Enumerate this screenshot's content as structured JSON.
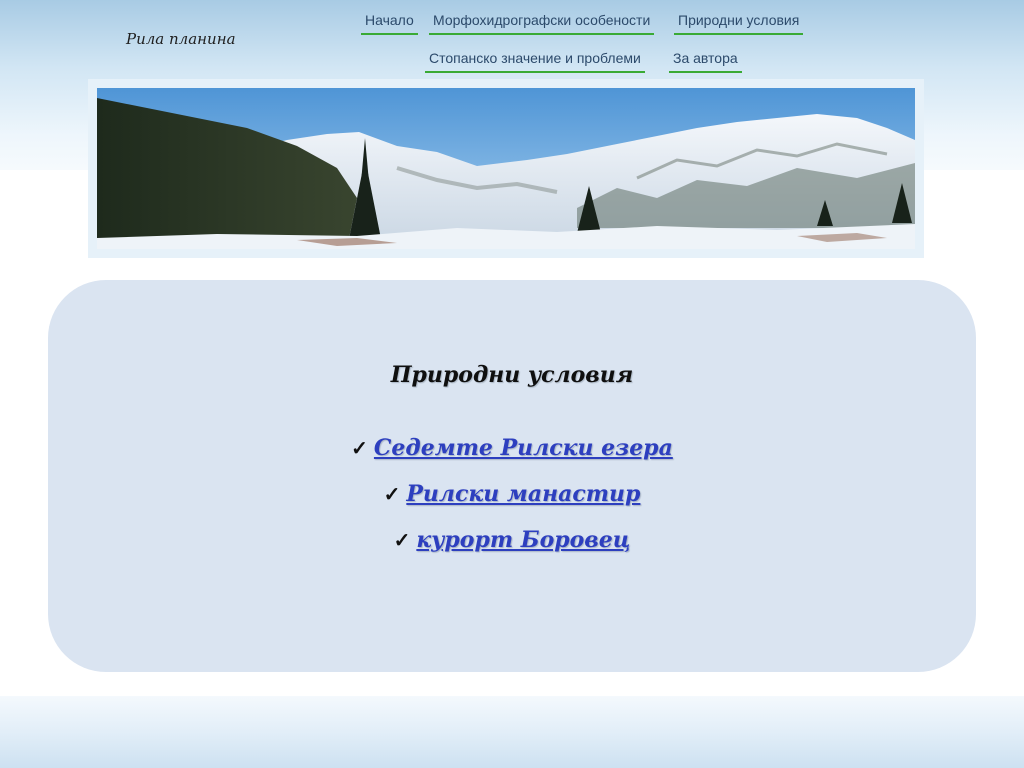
{
  "site": {
    "title": "Рила планина"
  },
  "nav": {
    "row1": [
      "Начало",
      "Морфохидрографски особености",
      "Природни условия"
    ],
    "row2": [
      "Стопанско значение и проблеми",
      "За автора"
    ]
  },
  "banner": {
    "image": "mountain-panorama-snow"
  },
  "content": {
    "title": "Природни условия",
    "check_symbol": "✓",
    "links": [
      "Седемте Рилски езера",
      "Рилски манастир",
      "курорт Боровец"
    ]
  },
  "colors": {
    "nav_underline": "#3aaa35",
    "nav_text": "#2c4a6b",
    "link": "#2d3fbf",
    "content_bg": "#dae4f1"
  }
}
